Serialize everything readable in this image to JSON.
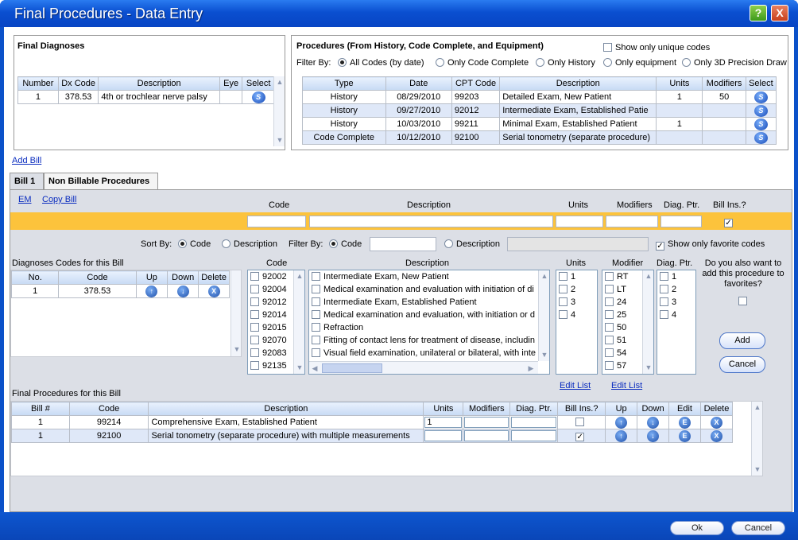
{
  "window": {
    "title": "Final Procedures - Data Entry",
    "help_label": "?",
    "close_label": "X"
  },
  "diagnoses": {
    "title": "Final Diagnoses",
    "headers": [
      "Number",
      "Dx Code",
      "Description",
      "Eye",
      "Select"
    ],
    "rows": [
      {
        "number": "1",
        "code": "378.53",
        "description": "4th or trochlear nerve palsy",
        "eye": "",
        "select": "S"
      }
    ]
  },
  "procedures": {
    "title": "Procedures (From History, Code Complete, and Equipment)",
    "show_unique_label": "Show only unique codes",
    "filter_label": "Filter By:",
    "filters": [
      "All Codes (by date)",
      "Only Code Complete",
      "Only History",
      "Only equipment",
      "Only 3D Precision Draw"
    ],
    "headers": [
      "Type",
      "Date",
      "CPT Code",
      "Description",
      "Units",
      "Modifiers",
      "Select"
    ],
    "rows": [
      {
        "type": "History",
        "date": "08/29/2010",
        "cpt": "99203",
        "description": "Detailed Exam, New Patient",
        "units": "1",
        "modifiers": "50",
        "select": "S"
      },
      {
        "type": "History",
        "date": "09/27/2010",
        "cpt": "92012",
        "description": "Intermediate  Exam,  Established Patie",
        "units": "",
        "modifiers": "",
        "select": "S"
      },
      {
        "type": "History",
        "date": "10/03/2010",
        "cpt": "99211",
        "description": "Minimal Exam, Established Patient",
        "units": "1",
        "modifiers": "",
        "select": "S"
      },
      {
        "type": "Code Complete",
        "date": "10/12/2010",
        "cpt": "92100",
        "description": "Serial tonometry (separate procedure)",
        "units": "",
        "modifiers": "",
        "select": "S"
      }
    ]
  },
  "add_bill_label": "Add Bill",
  "tabs": [
    "Bill 1",
    "Non Billable Procedures"
  ],
  "bill": {
    "em_label": "EM",
    "copy_bill_label": "Copy Bill",
    "entry_headers": {
      "code": "Code",
      "description": "Description",
      "units": "Units",
      "modifiers": "Modifiers",
      "diag_ptr": "Diag. Ptr.",
      "bill_ins": "Bill Ins.?"
    },
    "sort_by_label": "Sort By:",
    "sort_code": "Code",
    "sort_description": "Description",
    "filter_by_label": "Filter By:",
    "filter_code": "Code",
    "filter_description": "Description",
    "show_favorites_label": "Show only favorite codes",
    "diag_codes_title": "Diagnoses Codes for this Bill",
    "diag_headers": [
      "No.",
      "Code",
      "Up",
      "Down",
      "Delete"
    ],
    "diag_rows": [
      {
        "no": "1",
        "code": "378.53"
      }
    ],
    "list_headers": {
      "code": "Code",
      "description": "Description",
      "units": "Units",
      "modifier": "Modifier",
      "diag_ptr": "Diag. Ptr."
    },
    "code_list": [
      "92002",
      "92004",
      "92012",
      "92014",
      "92015",
      "92070",
      "92083",
      "92135"
    ],
    "description_list": [
      "Intermediate Exam, New Patient",
      "Medical examination and evaluation with initiation of di",
      "Intermediate Exam, Established Patient",
      "Medical examination and evaluation, with initiation or d",
      "Refraction",
      "Fitting of contact lens for treatment of disease, includin",
      "Visual field examination, unilateral or bilateral, with inte"
    ],
    "units_list": [
      "1",
      "2",
      "3",
      "4"
    ],
    "modifier_list": [
      "RT",
      "LT",
      "24",
      "25",
      "50",
      "51",
      "54",
      "57"
    ],
    "diag_ptr_list": [
      "1",
      "2",
      "3",
      "4"
    ],
    "favorites_question": "Do you also want to add this procedure to favorites?",
    "add_label": "Add",
    "cancel_label": "Cancel",
    "edit_list_label": "Edit List",
    "final_title": "Final Procedures for this Bill",
    "final_headers": [
      "Bill #",
      "Code",
      "Description",
      "Units",
      "Modifiers",
      "Diag. Ptr.",
      "Bill Ins.?",
      "Up",
      "Down",
      "Edit",
      "Delete"
    ],
    "final_rows": [
      {
        "bill": "1",
        "code": "99214",
        "description": "Comprehensive Exam, Established Patient",
        "units": "1",
        "bill_ins": false
      },
      {
        "bill": "1",
        "code": "92100",
        "description": "Serial tonometry (separate procedure) with multiple measurements",
        "units": "",
        "bill_ins": true
      }
    ]
  },
  "footer": {
    "ok_label": "Ok",
    "cancel_label": "Cancel"
  },
  "colors": {
    "title_blue": "#0a4fd0",
    "highlight_yellow": "#fcc33c",
    "grid_header": "#c7daf4"
  }
}
